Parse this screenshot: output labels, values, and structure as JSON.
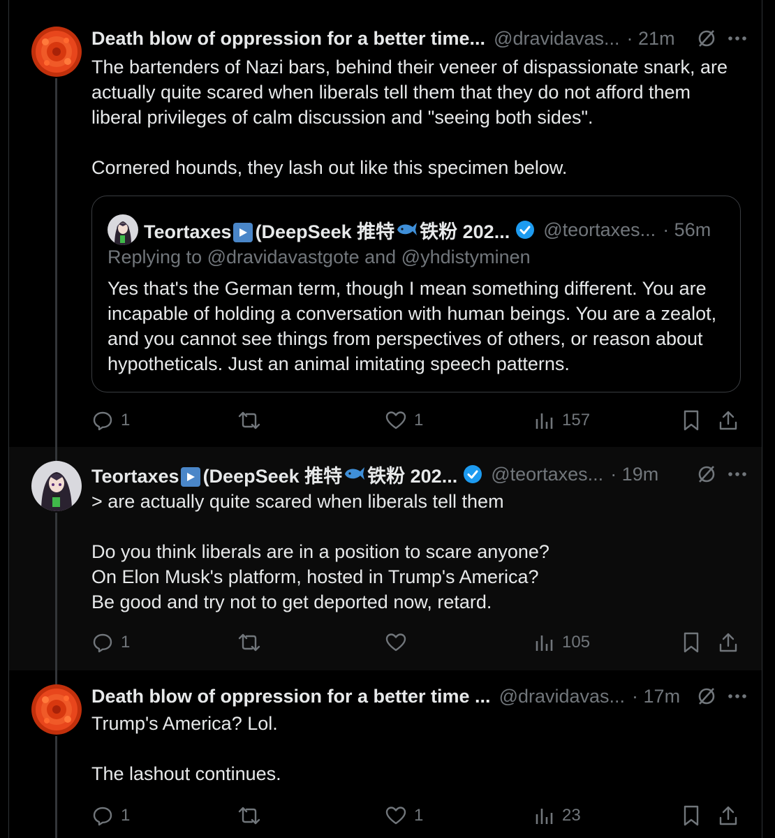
{
  "tweets": [
    {
      "author_name": "Death blow of oppression for a better time...",
      "handle": "@dravidavas...",
      "time": "· 21m",
      "body": "The bartenders of Nazi bars, behind their veneer of dispassionate snark, are actually quite scared when liberals tell them that they do not afford them liberal privileges of calm discussion and \"seeing both sides\".\n\nCornered hounds, they lash out like this specimen below.",
      "quote": {
        "name_a": "Teortaxes",
        "name_b": "(DeepSeek 推特",
        "name_c": "铁粉 202...",
        "handle": "@teortaxes...",
        "time": "· 56m",
        "replying": "Replying to @dravidavastgote and @yhdistyminen",
        "body": "Yes that's the German term, though I mean something different. You are incapable of holding a conversation with human beings. You are a zealot, and you cannot see things from perspectives of others, or reason about hypotheticals. Just an animal imitating speech patterns."
      },
      "stats": {
        "replies": "1",
        "reposts": "",
        "likes": "1",
        "views": "157"
      }
    },
    {
      "name_a": "Teortaxes",
      "name_b": "(DeepSeek 推特",
      "name_c": "铁粉 202...",
      "handle": "@teortaxes...",
      "time": "· 19m",
      "body": "> are actually quite scared when liberals tell them\n\nDo you think liberals are in a position to scare anyone?\nOn Elon Musk's platform, hosted in Trump's America?\nBe good and try not to get deported now, retard.",
      "stats": {
        "replies": "1",
        "reposts": "",
        "likes": "",
        "views": "105"
      }
    },
    {
      "author_name": "Death blow of oppression for a better time ...",
      "handle": "@dravidavas...",
      "time": "· 17m",
      "body": "Trump's America? Lol.\n\nThe lashout continues.",
      "stats": {
        "replies": "1",
        "reposts": "",
        "likes": "1",
        "views": "23"
      }
    }
  ],
  "icons": {
    "avatar_flower": "orange-flower",
    "avatar_anime": "anime-character",
    "verified": "verified-badge",
    "play": "play-flag",
    "whale": "whale-emoji",
    "grok": "grok-icon",
    "more": "more-icon",
    "reply": "reply-icon",
    "repost": "repost-icon",
    "like": "like-icon",
    "views": "views-icon",
    "bookmark": "bookmark-icon",
    "share": "share-icon"
  },
  "colors": {
    "background": "#000000",
    "text": "#e7e9ea",
    "muted": "#71767b",
    "verified": "#1d9bf0",
    "flower": "#e8461c"
  }
}
